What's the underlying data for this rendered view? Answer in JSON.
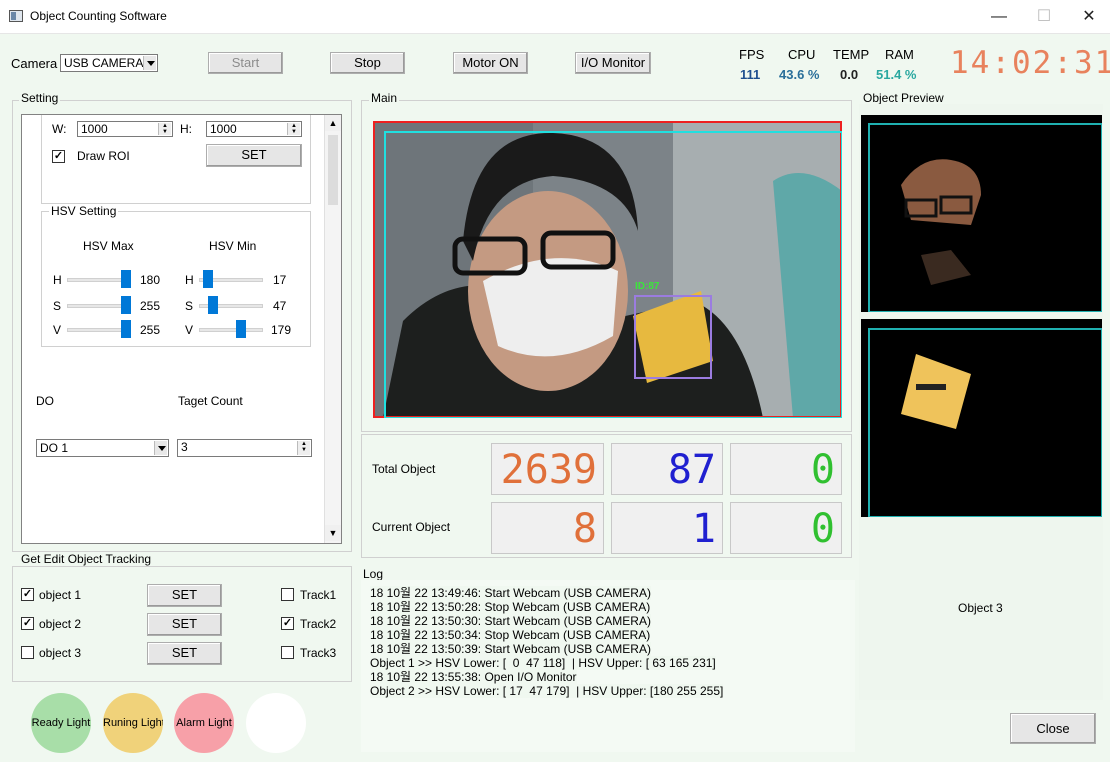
{
  "window": {
    "title": "Object Counting Software",
    "minimize": "—",
    "maximize": "☐",
    "close": "✕"
  },
  "toolbar": {
    "camera_label": "Camera",
    "camera_value": "USB CAMERA",
    "start": "Start",
    "stop": "Stop",
    "motor_on": "Motor ON",
    "io_monitor": "I/O Monitor"
  },
  "stats": {
    "fps_label": "FPS",
    "fps_value": "111",
    "cpu_label": "CPU",
    "cpu_value": "43.6 %",
    "temp_label": "TEMP",
    "temp_value": "0.0",
    "ram_label": "RAM",
    "ram_value": "51.4 %",
    "clock": "14:02:31"
  },
  "setting": {
    "title": "Setting",
    "w_label": "W:",
    "w_value": "1000",
    "h_label": "H:",
    "h_value": "1000",
    "draw_roi": "Draw ROI",
    "set": "SET",
    "hsv_title": "HSV Setting",
    "hsv_max": "HSV Max",
    "hsv_min": "HSV Min",
    "max": {
      "h_label": "H",
      "h": "180",
      "s_label": "S",
      "s": "255",
      "v_label": "V",
      "v": "255"
    },
    "min": {
      "h_label": "H",
      "h": "17",
      "s_label": "S",
      "s": "47",
      "v_label": "V",
      "v": "179"
    },
    "slider_levels": {
      "max_h": 1.0,
      "max_s": 1.0,
      "max_v": 1.0,
      "min_h": 0.09,
      "min_s": 0.18,
      "min_v": 0.7
    },
    "do_label": "DO",
    "do_value": "DO 1",
    "target_label": "Taget Count",
    "target_value": "3"
  },
  "get_edit": {
    "title": "Get Edit Object   Tracking",
    "rows": [
      {
        "object": "object 1",
        "checked": true,
        "set": "SET",
        "track": "Track1",
        "track_checked": false
      },
      {
        "object": "object 2",
        "checked": true,
        "set": "SET",
        "track": "Track2",
        "track_checked": true
      },
      {
        "object": "object 3",
        "checked": false,
        "set": "SET",
        "track": "Track3",
        "track_checked": false
      }
    ]
  },
  "lights": {
    "ready": "Ready Light",
    "running": "Runing Light",
    "alarm": "Alarm Light",
    "colors": {
      "ready": "#a8dea8",
      "running": "#f0d27a",
      "alarm": "#f7a0a8",
      "off": "#ffffff"
    }
  },
  "main": {
    "title": "Main",
    "overlay_label": "ID:87"
  },
  "counters": {
    "total_label": "Total Object",
    "current_label": "Current Object",
    "total": [
      "2639",
      "87",
      "0"
    ],
    "current": [
      "8",
      "1",
      "0"
    ],
    "colors": [
      "#e0703a",
      "#2020d0",
      "#30c030"
    ]
  },
  "log": {
    "title": "Log",
    "lines": [
      "18 10월 22 13:49:46: Start Webcam (USB CAMERA)",
      "18 10월 22 13:50:28: Stop Webcam (USB CAMERA)",
      "18 10월 22 13:50:30: Start Webcam (USB CAMERA)",
      "18 10월 22 13:50:34: Stop Webcam (USB CAMERA)",
      "18 10월 22 13:50:39: Start Webcam (USB CAMERA)",
      "Object 1 >> HSV Lower: [  0  47 118]  | HSV Upper: [ 63 165 231]",
      "18 10월 22 13:55:38: Open I/O Monitor",
      "Object 2 >> HSV Lower: [ 17  47 179]  | HSV Upper: [180 255 255]"
    ]
  },
  "preview": {
    "title": "Object Preview",
    "object3": "Object 3"
  },
  "footer": {
    "close": "Close"
  }
}
